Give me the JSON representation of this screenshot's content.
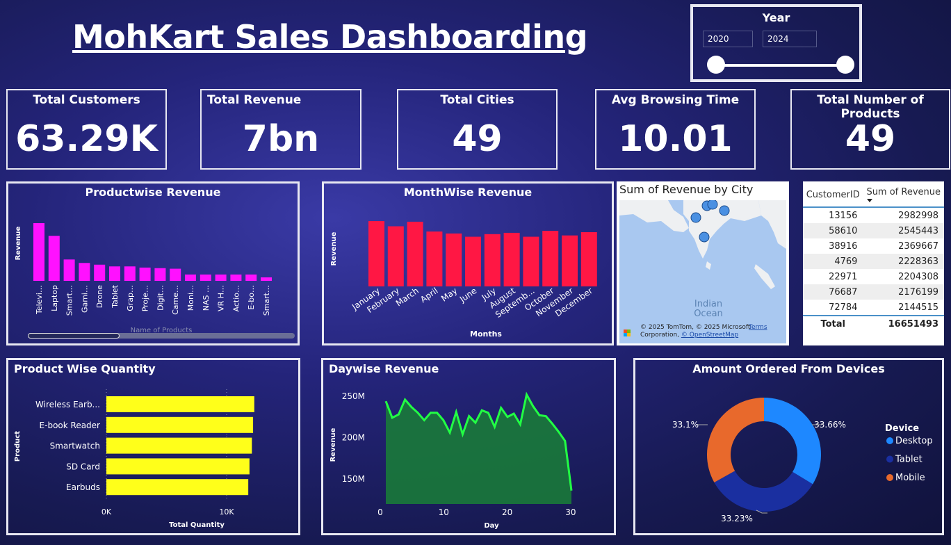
{
  "title": "MohKart Sales Dashboarding",
  "slicer": {
    "label": "Year",
    "from": "2020",
    "to": "2024"
  },
  "kpis": [
    {
      "title": "Total Customers",
      "value": "63.29K"
    },
    {
      "title": "Total Revenue",
      "value": "7bn"
    },
    {
      "title": "Total Cities",
      "value": "49"
    },
    {
      "title": "Avg Browsing Time",
      "value": "10.01"
    },
    {
      "title": "Total Number of Products",
      "value": "49"
    }
  ],
  "colors": {
    "product_bar": "#ff11ff",
    "month_bar": "#ff1744",
    "qty_bar": "#ffff1a",
    "day_line": "#22ff44",
    "day_fill": "#1a7a3a",
    "desktop": "#1e88ff",
    "tablet": "#1a2fa0",
    "mobile": "#e8692c"
  },
  "chart_data": [
    {
      "id": "productwise",
      "type": "bar",
      "title": "Productwise Revenue",
      "xlabel": "Name of Products",
      "ylabel": "Revenue",
      "categories": [
        "Televi…",
        "Laptop",
        "Smart…",
        "Gami…",
        "Drone",
        "Tablet",
        "Grap…",
        "Proje…",
        "Digit…",
        "Came…",
        "Moni…",
        "NAS …",
        "VR H…",
        "Actio…",
        "E-bo…",
        "Smart…"
      ],
      "values": [
        100,
        78,
        37,
        31,
        28,
        25,
        25,
        23,
        22,
        21,
        11,
        11,
        11,
        11,
        11,
        6
      ]
    },
    {
      "id": "monthwise",
      "type": "bar",
      "title": "MonthWise Revenue",
      "xlabel": "Months",
      "ylabel": "Revenue",
      "categories": [
        "January",
        "February",
        "March",
        "April",
        "May",
        "June",
        "July",
        "August",
        "Septemb...",
        "October",
        "November",
        "December"
      ],
      "values": [
        100,
        92,
        99,
        84,
        81,
        76,
        80,
        82,
        76,
        85,
        78,
        83
      ]
    },
    {
      "id": "quantity",
      "type": "bar",
      "title": "Product Wise Quantity",
      "xlabel": "Total Quantity",
      "ylabel": "Product",
      "categories": [
        "Wireless Earb...",
        "E-book Reader",
        "Smartwatch",
        "SD Card",
        "Earbuds"
      ],
      "values": [
        12300,
        12200,
        12100,
        11900,
        11800
      ],
      "xticks": [
        "0K",
        "10K"
      ],
      "xlim": [
        0,
        14000
      ]
    },
    {
      "id": "daywise",
      "type": "area",
      "title": "Daywise Revenue",
      "xlabel": "Day",
      "ylabel": "Revenue",
      "x": [
        1,
        2,
        3,
        4,
        5,
        6,
        7,
        8,
        9,
        10,
        11,
        12,
        13,
        14,
        15,
        16,
        17,
        18,
        19,
        20,
        21,
        22,
        23,
        24,
        25,
        26,
        27,
        28,
        29,
        30,
        31
      ],
      "y": [
        244,
        224,
        228,
        246,
        237,
        230,
        221,
        230,
        230,
        221,
        206,
        231,
        204,
        226,
        218,
        233,
        230,
        213,
        236,
        225,
        229,
        216,
        252,
        238,
        227,
        226,
        217,
        207,
        196,
        136
      ],
      "yticks": [
        "150M",
        "200M",
        "250M"
      ],
      "ytick_values": [
        150,
        200,
        250
      ],
      "xticks": [
        "0",
        "10",
        "20",
        "30"
      ],
      "ylim": [
        130,
        262
      ],
      "xlim": [
        0,
        32
      ]
    },
    {
      "id": "devices",
      "type": "pie",
      "title": "Amount Ordered From Devices",
      "legend_title": "Device",
      "labels": [
        "Desktop",
        "Tablet",
        "Mobile"
      ],
      "values": [
        33.66,
        33.23,
        33.1
      ],
      "value_labels": [
        "33.66%",
        "33.23%",
        "33.1%"
      ]
    }
  ],
  "map": {
    "title": "Sum of Revenue by City",
    "ocean_label_1": "Indian",
    "ocean_label_2": "Ocean",
    "copyright": "© 2025 TomTom, © 2025 Microsoft Corporation,",
    "osm": "© OpenStreetMap",
    "terms": "Terms",
    "brand": "Microsoft"
  },
  "table": {
    "headers": [
      "CustomerID",
      "Sum of Revenue"
    ],
    "rows": [
      [
        "13156",
        "2982998"
      ],
      [
        "58610",
        "2545443"
      ],
      [
        "38916",
        "2369667"
      ],
      [
        "4769",
        "2228363"
      ],
      [
        "22971",
        "2204308"
      ],
      [
        "76687",
        "2176199"
      ],
      [
        "72784",
        "2144515"
      ]
    ],
    "total_label": "Total",
    "total_value": "16651493"
  }
}
